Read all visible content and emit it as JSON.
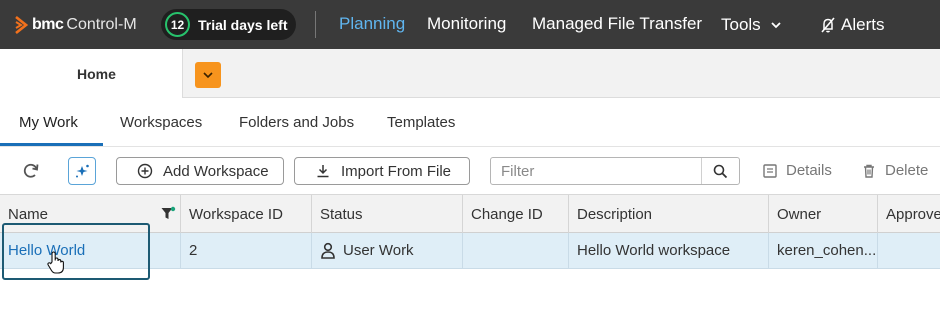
{
  "topbar": {
    "brand": "bmc",
    "product": "Control-M",
    "trial_days": "12",
    "trial_label": "Trial days left",
    "nav": {
      "planning": "Planning",
      "monitoring": "Monitoring",
      "mft": "Managed File Transfer",
      "tools": "Tools",
      "alerts": "Alerts"
    },
    "active_nav": "Planning"
  },
  "tabs": {
    "home": "Home"
  },
  "subtabs": {
    "my_work": "My Work",
    "workspaces": "Workspaces",
    "folders_jobs": "Folders and Jobs",
    "templates": "Templates",
    "active": "My Work"
  },
  "toolbar": {
    "add_workspace": "Add Workspace",
    "import_from_file": "Import From File",
    "filter_placeholder": "Filter",
    "details": "Details",
    "delete": "Delete"
  },
  "table": {
    "columns": [
      "Name",
      "Workspace ID",
      "Status",
      "Change ID",
      "Description",
      "Owner",
      "Approve"
    ],
    "rows": [
      {
        "name": "Hello World",
        "workspace_id": "2",
        "status": "User Work",
        "change_id": "",
        "description": "Hello World workspace",
        "owner": "keren_cohen...",
        "approve": ""
      }
    ]
  },
  "colors": {
    "topbar_bg": "#3a3a3a",
    "active_nav": "#60b6f0",
    "trial_ring": "#27c26c",
    "tab_menu": "#f7941d",
    "link": "#1a6fb8",
    "selected_row": "#dfeef7",
    "highlight_border": "#1d5a73"
  }
}
